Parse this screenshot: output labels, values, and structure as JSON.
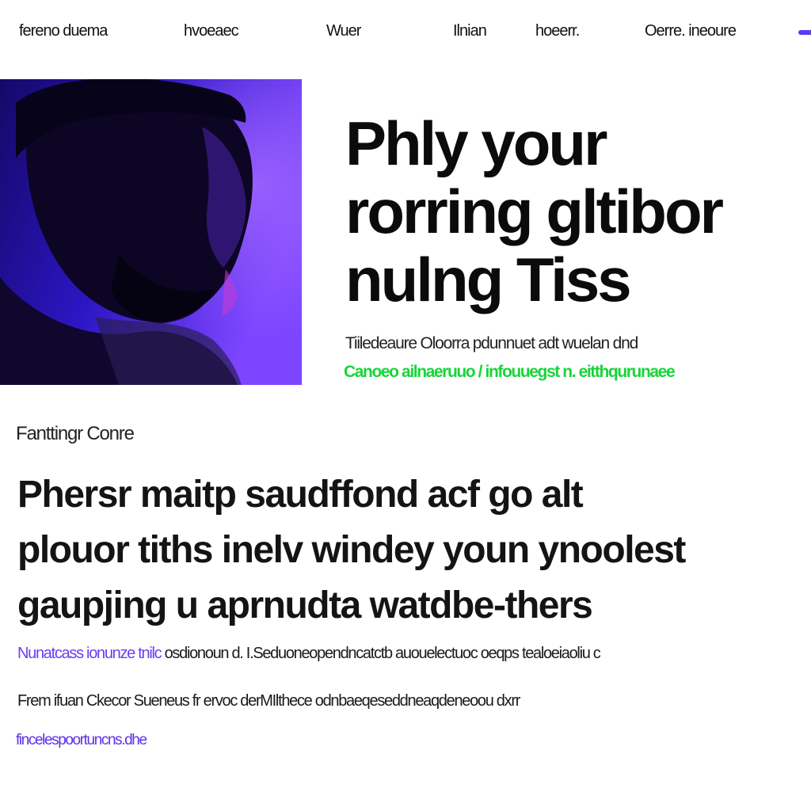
{
  "nav": {
    "links": [
      "fereno duema",
      "hvoeaec",
      "Wuer",
      "Ilnian",
      "hoeerr.",
      "Oerre. ineoure"
    ]
  },
  "hero": {
    "title_lines": [
      "Phly your",
      "rorring gltibor",
      "nulng Tiss"
    ],
    "subtitle": "Tiiledeaure Oloorra pdunnuet adt wuelan dnd",
    "link_text": "Canoeo ailnaeruuo / infouuegst n. eitthqurunaee"
  },
  "feature": {
    "label": "Fanttingr Conre",
    "heading_lines": [
      "Phersr maitp saudffond acf go alt",
      "plouor tiths inelv windey youn ynoolest",
      "gaupjing u aprnudta watdbe-thers"
    ],
    "body_line_1_link": "Nunatcass ionunze tnilc",
    "body_line_1_rest": "osdionoun d. I.Seduoneopendncatctb auouelectuoc oeqps tealoeiaoliu c",
    "body_line_2": "Frem ifuan Ckecor Sueneus fr ervoc derMIlthece odnbaeqeseddneaqdeneoou dxrr",
    "footer_link": "fincelespoortuncns.dhe"
  },
  "colors": {
    "accent_purple": "#5b3df0",
    "accent_green": "#19d43a",
    "hero_gradient_start": "#1a0a6e",
    "hero_gradient_end": "#8a4cff"
  },
  "icons": {
    "nav_accent": "menu-accent-icon"
  }
}
